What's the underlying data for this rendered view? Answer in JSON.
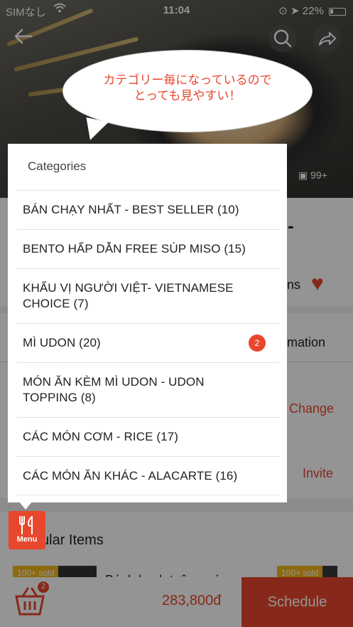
{
  "status_bar": {
    "carrier": "SIMなし",
    "time": "11:04",
    "battery": "22%"
  },
  "hero": {
    "photo_count": "99+"
  },
  "bubble": {
    "line1": "カテゴリー毎になっているので",
    "line2": "とっても見やすい！"
  },
  "categories": {
    "title": "Categories",
    "items": [
      {
        "label": "BÁN CHẠY NHẤT - BEST SELLER (10)",
        "badge": ""
      },
      {
        "label": "BENTO HẤP DẪN FREE SÚP MISO (15)",
        "badge": ""
      },
      {
        "label": "KHẨU VỊ NGƯỜI VIỆT- VIETNAMESE CHOICE (7)",
        "badge": ""
      },
      {
        "label": "MÌ UDON  (20)",
        "badge": "2"
      },
      {
        "label": "MÓN ĂN KÈM MÌ UDON - UDON TOPPING (8)",
        "badge": ""
      },
      {
        "label": "CÁC MÓN CƠM - RICE (17)",
        "badge": ""
      },
      {
        "label": "CÁC MÓN ĂN KHÁC - ALACARTE (16)",
        "badge": ""
      }
    ]
  },
  "background": {
    "title_fragment": "-",
    "ns_fragment": "ns",
    "tab_fragment": "mation",
    "change_label": "Change",
    "invite_label": "Invite",
    "popular_items": "ular Items",
    "sold_tag": "100+ sold",
    "item_name_fragment": "Bánh bạch tuộc nướ"
  },
  "menu_button": {
    "label": "Menu"
  },
  "cart": {
    "count": "2",
    "total": "283,800đ"
  },
  "schedule_button": {
    "label": "Schedule"
  },
  "colors": {
    "accent": "#e8472d",
    "sold_tag": "#f2b71b"
  }
}
